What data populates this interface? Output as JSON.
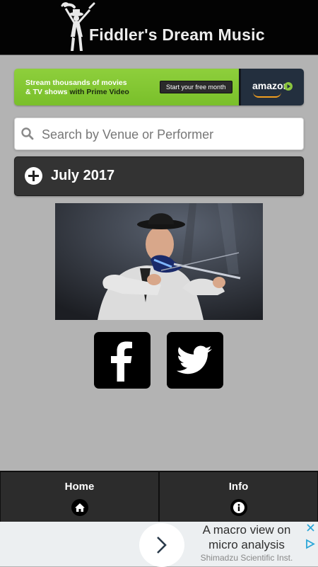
{
  "header": {
    "title": "Fiddler's Dream Music"
  },
  "top_ad": {
    "line1": "Stream thousands of movies",
    "line2_prefix": "& TV shows ",
    "line2_highlight": "with Prime Video",
    "cta": "Start your free month",
    "brand": "amazon",
    "colors": {
      "green": "#84c735",
      "brand_bg": "#232f3e",
      "smile": "#f19e1f"
    }
  },
  "search": {
    "placeholder": "Search by Venue or Performer",
    "value": ""
  },
  "month_section": {
    "label": "July 2017",
    "icon": "plus-circle-icon"
  },
  "social": {
    "facebook_icon": "facebook-icon",
    "twitter_icon": "twitter-icon"
  },
  "bottom_nav": {
    "tabs": [
      {
        "label": "Home",
        "icon": "home-icon"
      },
      {
        "label": "Info",
        "icon": "info-icon"
      }
    ]
  },
  "bottom_ad": {
    "headline": "A macro view on micro analysis",
    "sponsor": "Shimadzu Scientific Inst."
  },
  "colors": {
    "page_bg": "#b3b3b3",
    "header_bg": "#030303",
    "panel_bg": "#333333"
  }
}
